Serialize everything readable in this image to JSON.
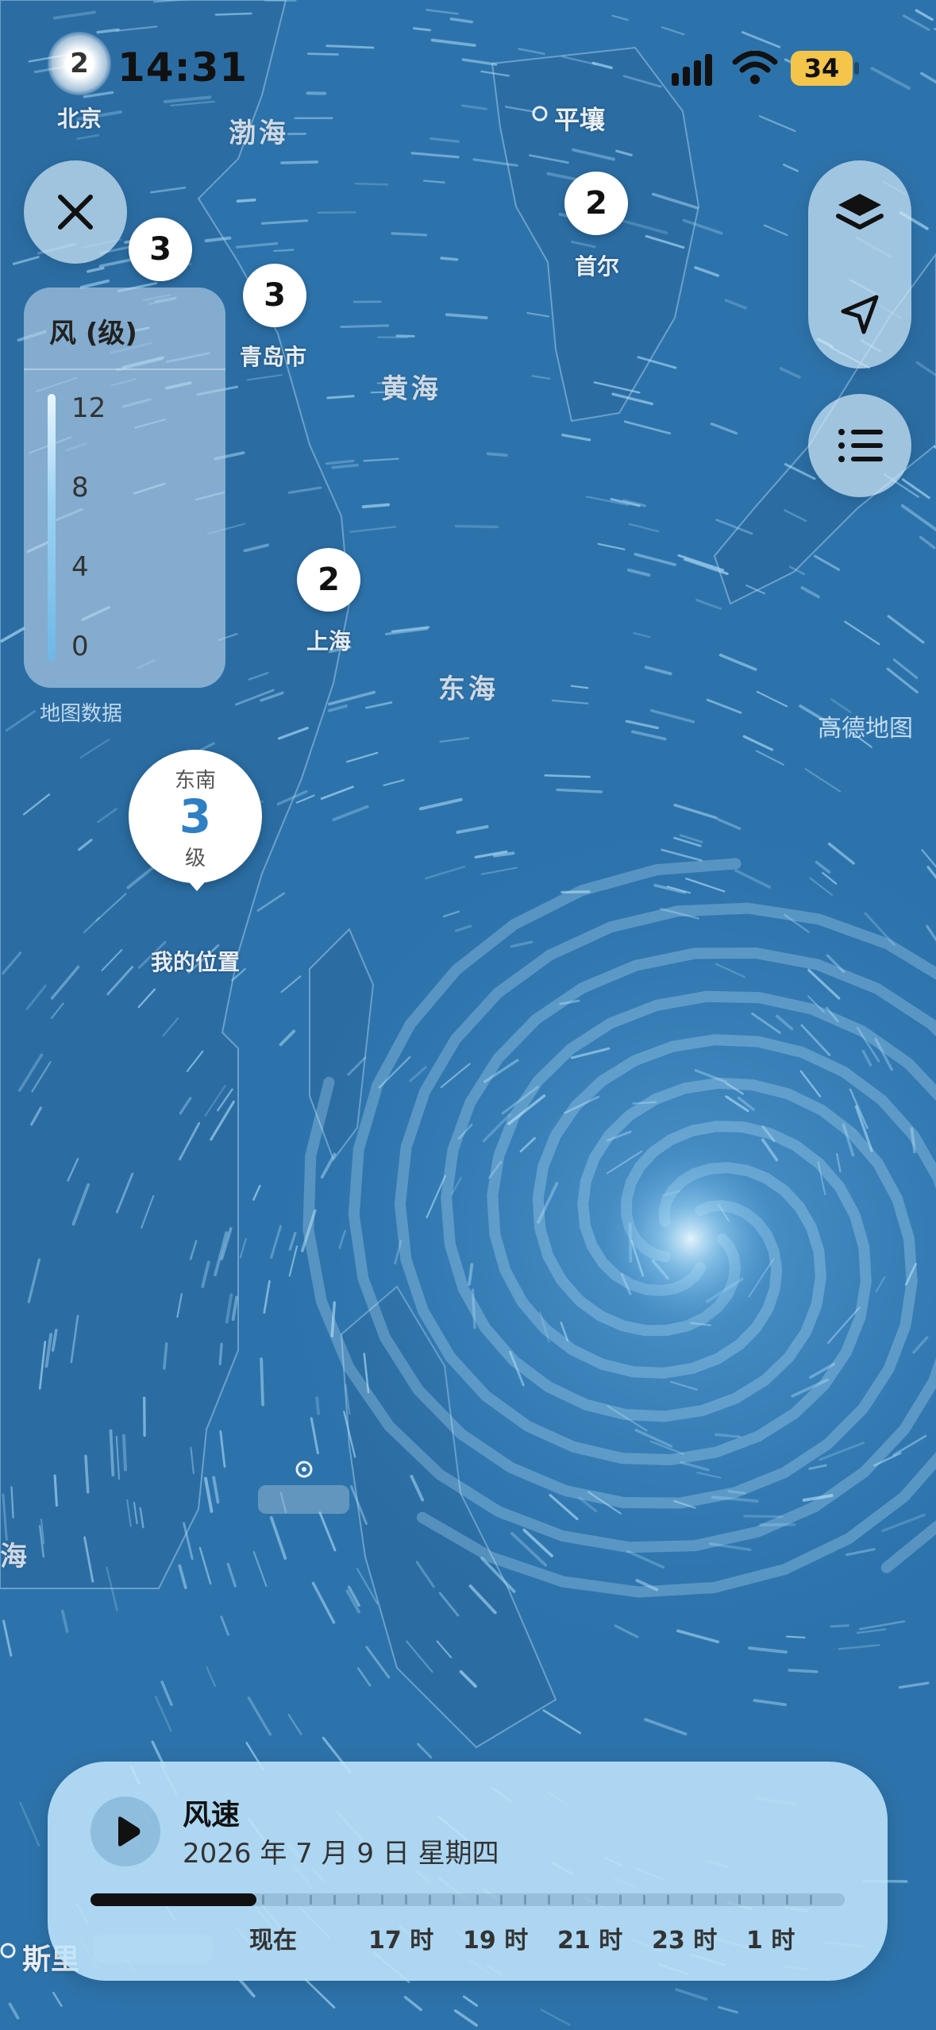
{
  "status_bar": {
    "time": "14:31",
    "battery": "34",
    "avatar": "2"
  },
  "legend": {
    "title": "风 (级)",
    "ticks": [
      "12",
      "8",
      "4",
      "0"
    ]
  },
  "map_credits": {
    "left": "地图数据",
    "right": "高德地图"
  },
  "cities": {
    "beijing": "北京",
    "pyongyang": "平壤",
    "seoul": "首尔",
    "qingdao": "青岛市",
    "shanghai": "上海",
    "my_location": "我的位置",
    "bottom_left": "斯里"
  },
  "seas": {
    "bohai": "渤海",
    "yellow_sea": "黄海",
    "east_sea": "东海",
    "left_edge": "海"
  },
  "wind_badges": {
    "top_left": "3",
    "qingdao": "3",
    "seoul": "2",
    "shanghai": "2"
  },
  "my_location_bubble": {
    "direction": "东南",
    "level": "3",
    "unit": "级"
  },
  "timeline": {
    "title": "风速",
    "date": "2026 年 7 月 9 日 星期四",
    "labels": [
      "现在",
      "17 时",
      "19 时",
      "21 时",
      "23 时",
      "1 时"
    ],
    "progress": 0.22
  },
  "icons": {
    "close": "close-icon",
    "layers": "layers-icon",
    "location": "location-arrow-icon",
    "list": "list-icon",
    "play": "play-icon"
  },
  "colors": {
    "ocean": "#2d73ab",
    "land": "#2b6da3",
    "streak": "#a8d8f5",
    "accent": "#2e7fc4"
  }
}
